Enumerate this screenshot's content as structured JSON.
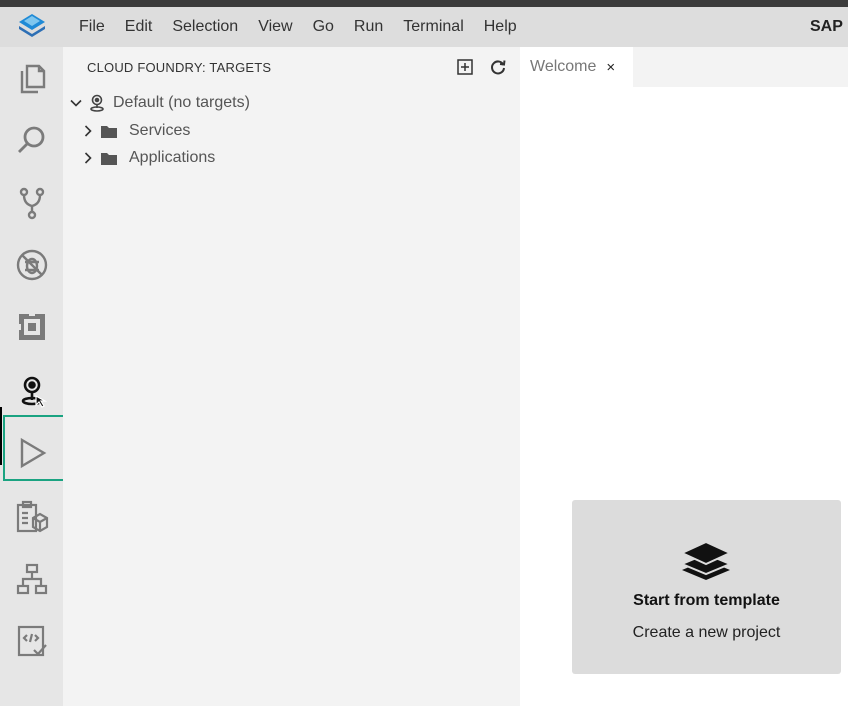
{
  "menubar": {
    "items": [
      "File",
      "Edit",
      "Selection",
      "View",
      "Go",
      "Run",
      "Terminal",
      "Help"
    ],
    "brand": "SAP"
  },
  "activitybar": {
    "items": [
      {
        "name": "explorer-icon"
      },
      {
        "name": "search-icon"
      },
      {
        "name": "source-control-icon"
      },
      {
        "name": "debug-icon"
      },
      {
        "name": "extensions-icon"
      },
      {
        "name": "cloud-foundry-targets-icon"
      },
      {
        "name": "run-icon"
      },
      {
        "name": "task-explorer-icon"
      },
      {
        "name": "hierarchy-icon"
      },
      {
        "name": "code-check-icon"
      }
    ],
    "active": "cloud-foundry-targets-icon",
    "highlight_color": "#1aa381"
  },
  "sidebar": {
    "title": "CLOUD FOUNDRY: TARGETS",
    "actions": [
      {
        "name": "add-target-icon"
      },
      {
        "name": "refresh-icon"
      }
    ],
    "tree": {
      "root_label": "Default (no targets)",
      "children": [
        "Services",
        "Applications"
      ]
    }
  },
  "editor": {
    "tabs": [
      {
        "label": "Welcome",
        "close": "×"
      }
    ]
  },
  "welcome_card": {
    "title": "Start from template",
    "subtitle": "Create a new project"
  }
}
